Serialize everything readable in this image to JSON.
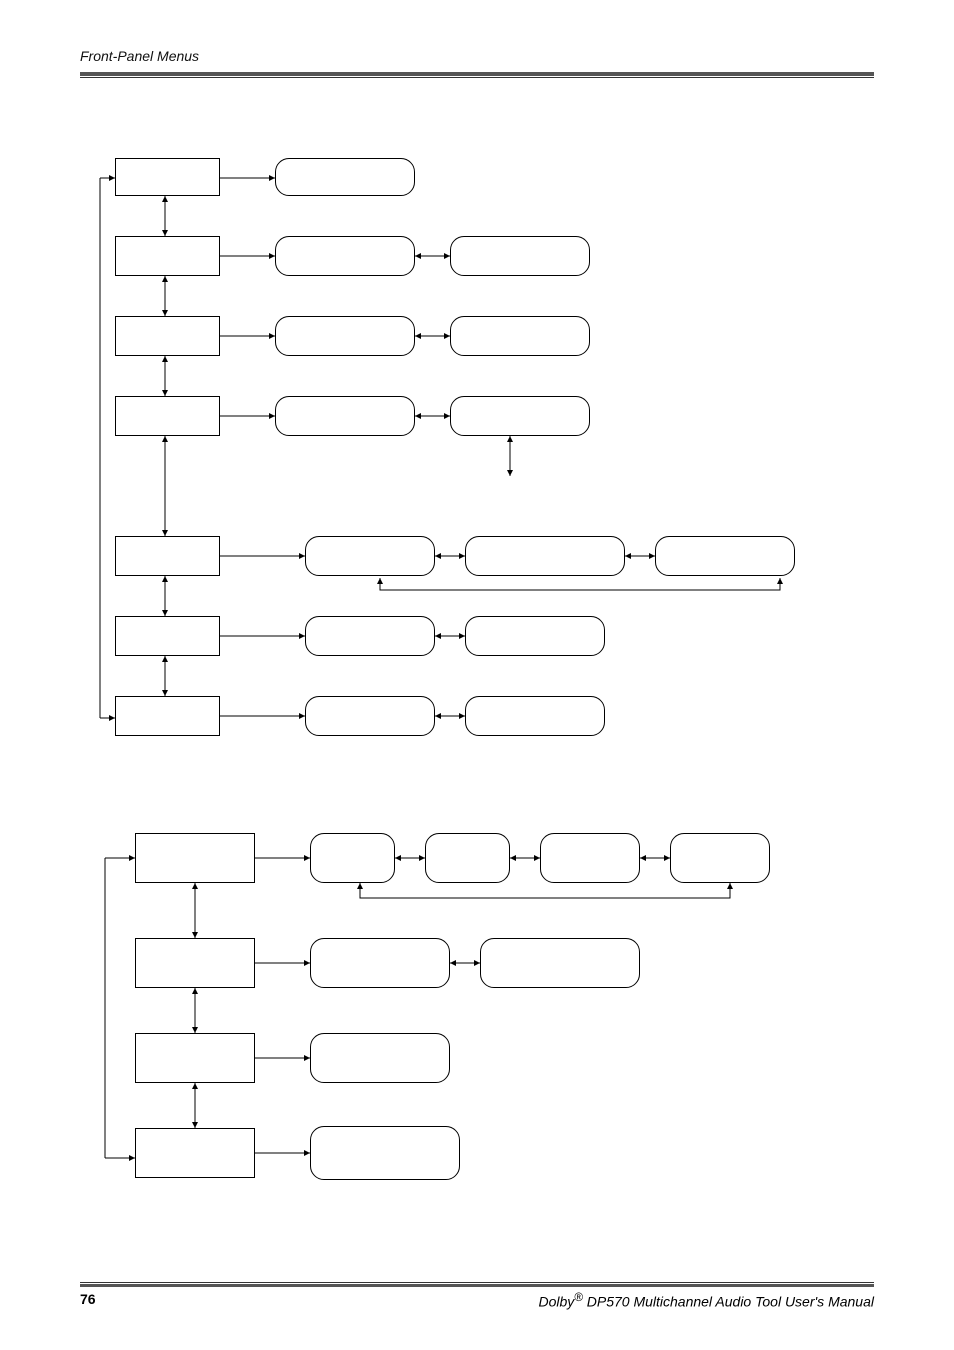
{
  "header": "Front-Panel Menus",
  "footer_page": "76",
  "footer_title_prefix": "Dolby",
  "footer_reg": "®",
  "footer_title_suffix": " DP570 Multichannel Audio Tool User's Manual"
}
